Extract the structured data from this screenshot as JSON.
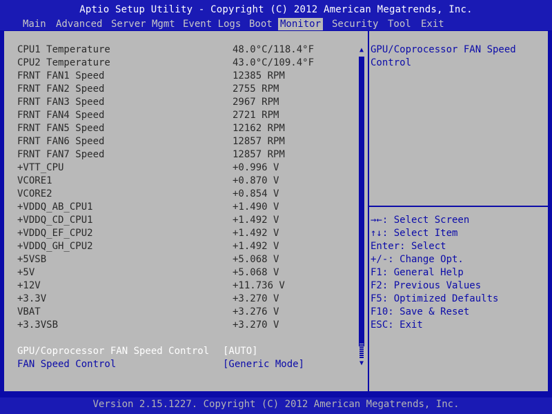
{
  "header": {
    "title": "Aptio Setup Utility - Copyright (C) 2012 American Megatrends, Inc."
  },
  "menu": {
    "tabs": [
      "Main",
      "Advanced",
      "Server Mgmt",
      "Event Logs",
      "Boot",
      "Monitor",
      "Security",
      "Tool",
      "Exit"
    ],
    "active": "Monitor"
  },
  "readings": [
    {
      "label": "CPU1 Temperature",
      "value": "48.0°C/118.4°F"
    },
    {
      "label": "CPU2 Temperature",
      "value": "43.0°C/109.4°F"
    },
    {
      "label": "FRNT FAN1 Speed",
      "value": "12385 RPM"
    },
    {
      "label": "FRNT FAN2 Speed",
      "value": "2755 RPM"
    },
    {
      "label": "FRNT FAN3 Speed",
      "value": "2967 RPM"
    },
    {
      "label": "FRNT FAN4 Speed",
      "value": "2721 RPM"
    },
    {
      "label": "FRNT FAN5 Speed",
      "value": "12162 RPM"
    },
    {
      "label": "FRNT FAN6 Speed",
      "value": "12857 RPM"
    },
    {
      "label": "FRNT FAN7 Speed",
      "value": "12857 RPM"
    },
    {
      "label": "+VTT_CPU",
      "value": "+0.996 V"
    },
    {
      "label": "VCORE1",
      "value": "+0.870 V"
    },
    {
      "label": "VCORE2",
      "value": "+0.854 V"
    },
    {
      "label": "+VDDQ_AB_CPU1",
      "value": "+1.490 V"
    },
    {
      "label": "+VDDQ_CD_CPU1",
      "value": "+1.492 V"
    },
    {
      "label": "+VDDQ_EF_CPU2",
      "value": "+1.492 V"
    },
    {
      "label": "+VDDQ_GH_CPU2",
      "value": "+1.492 V"
    },
    {
      "label": "+5VSB",
      "value": "+5.068 V"
    },
    {
      "label": "+5V",
      "value": "+5.068 V"
    },
    {
      "label": "+12V",
      "value": "+11.736 V"
    },
    {
      "label": "+3.3V",
      "value": "+3.270 V"
    },
    {
      "label": "VBAT",
      "value": "+3.276 V"
    },
    {
      "label": "+3.3VSB",
      "value": "+3.270 V"
    }
  ],
  "options": [
    {
      "label": "GPU/Coprocessor FAN Speed Control",
      "value": "[AUTO]",
      "selected": true
    },
    {
      "label": "FAN Speed Control",
      "value": "[Generic Mode]",
      "selected": false
    }
  ],
  "help": {
    "lines": [
      "GPU/Coprocessor FAN Speed",
      "Control"
    ]
  },
  "keys": [
    "→←: Select Screen",
    "↑↓: Select Item",
    "Enter: Select",
    "+/-: Change Opt.",
    "F1: General Help",
    "F2: Previous Values",
    "F5: Optimized Defaults",
    "F10: Save & Reset",
    "ESC: Exit"
  ],
  "footer": {
    "text": "Version 2.15.1227. Copyright (C) 2012 American Megatrends, Inc."
  },
  "colors": {
    "background": "#0b0ba8",
    "panel": "#b9b9b9",
    "accent": "#0b0ba8",
    "selected_text": "#ffffff"
  },
  "scroll": {
    "up_icon": "scroll-up-arrow-icon",
    "down_icon": "scroll-down-arrow-icon"
  }
}
